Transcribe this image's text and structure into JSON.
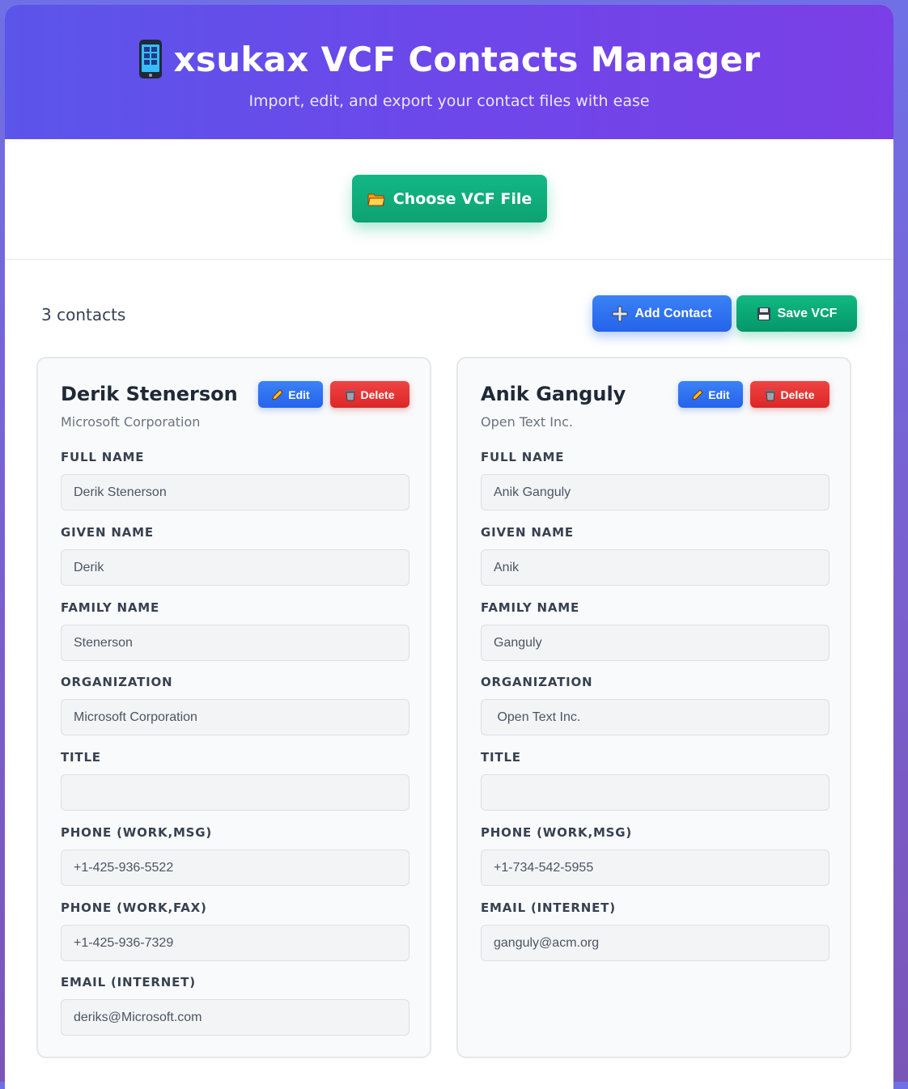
{
  "header": {
    "title": "xsukax VCF Contacts Manager",
    "subtitle": "Import, edit, and export your contact files with ease",
    "icon": "mobile-phone-icon"
  },
  "upload": {
    "choose_label": "Choose VCF File",
    "icon": "folder-icon"
  },
  "toolbar": {
    "count_label": "3 contacts",
    "add_label": "Add Contact",
    "save_label": "Save VCF"
  },
  "card_actions": {
    "edit_label": "Edit",
    "delete_label": "Delete"
  },
  "contacts": [
    {
      "name": "Derik Stenerson",
      "org": "Microsoft Corporation",
      "fields": [
        {
          "label": "FULL NAME",
          "value": "Derik Stenerson"
        },
        {
          "label": "GIVEN NAME",
          "value": "Derik"
        },
        {
          "label": "FAMILY NAME",
          "value": "Stenerson"
        },
        {
          "label": "ORGANIZATION",
          "value": "Microsoft Corporation"
        },
        {
          "label": "TITLE",
          "value": ""
        },
        {
          "label": "PHONE (WORK,MSG)",
          "value": "+1-425-936-5522"
        },
        {
          "label": "PHONE (WORK,FAX)",
          "value": "+1-425-936-7329"
        },
        {
          "label": "EMAIL (INTERNET)",
          "value": "deriks@Microsoft.com"
        }
      ]
    },
    {
      "name": "Anik Ganguly",
      "org": "Open Text Inc.",
      "fields": [
        {
          "label": "FULL NAME",
          "value": "Anik Ganguly"
        },
        {
          "label": "GIVEN NAME",
          "value": "Anik"
        },
        {
          "label": "FAMILY NAME",
          "value": "Ganguly"
        },
        {
          "label": "ORGANIZATION",
          "value": " Open Text Inc."
        },
        {
          "label": "TITLE",
          "value": ""
        },
        {
          "label": "PHONE (WORK,MSG)",
          "value": "+1-734-542-5955"
        },
        {
          "label": "EMAIL (INTERNET)",
          "value": "ganguly@acm.org"
        }
      ]
    }
  ],
  "colors": {
    "header_gradient_start": "#5b55ea",
    "header_gradient_end": "#7a3fe6",
    "primary_green": "#10b981",
    "primary_blue": "#2563eb",
    "danger_red": "#dc2626"
  }
}
